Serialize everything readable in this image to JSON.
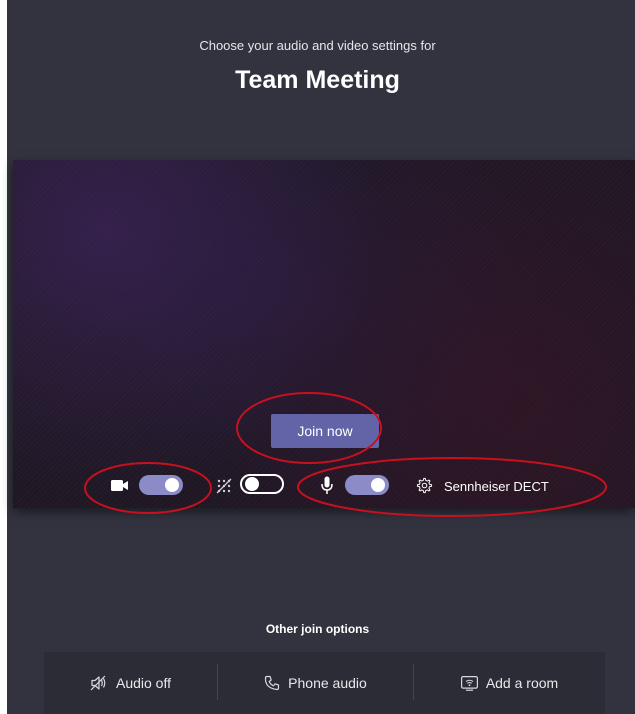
{
  "header": {
    "subtitle": "Choose your audio and video settings for",
    "meeting_title": "Team Meeting"
  },
  "preview": {
    "join_button_label": "Join now"
  },
  "controls": {
    "camera": {
      "icon": "video-camera-icon",
      "state": "on"
    },
    "background_blur": {
      "icon": "background-blur-icon",
      "state": "off"
    },
    "microphone": {
      "icon": "microphone-icon",
      "state": "on"
    },
    "device_settings": {
      "icon": "gear-icon",
      "label": "Sennheiser DECT"
    }
  },
  "other_options": {
    "title": "Other join options",
    "items": [
      {
        "icon": "speaker-off-icon",
        "label": "Audio off"
      },
      {
        "icon": "phone-icon",
        "label": "Phone audio"
      },
      {
        "icon": "cast-room-icon",
        "label": "Add a room"
      }
    ]
  },
  "colors": {
    "background": "#33333f",
    "accent": "#6264a7",
    "toggle_on": "#8b8cc7",
    "annotation": "#c8101e"
  }
}
